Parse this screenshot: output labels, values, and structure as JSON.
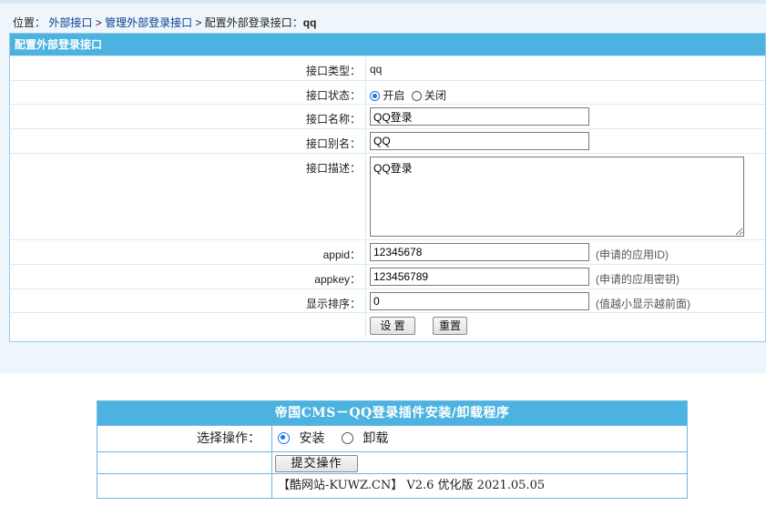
{
  "breadcrumb": {
    "prefix": "位置：",
    "item1": "外部接口",
    "sep1": " > ",
    "item2": "管理外部登录接口",
    "sep2": " > ",
    "item3": "配置外部登录接口：",
    "item3_bold": "qq"
  },
  "form": {
    "header": "配置外部登录接口",
    "type_label": "接口类型：",
    "type_value": "qq",
    "status_label": "接口状态：",
    "status_on": "开启",
    "status_off": "关闭",
    "status_selected": "开启",
    "name_label": "接口名称：",
    "name_value": "QQ登录",
    "alias_label": "接口别名：",
    "alias_value": "QQ",
    "desc_label": "接口描述：",
    "desc_value": "QQ登录",
    "appid_label": "appid：",
    "appid_value": "12345678",
    "appid_hint": "(申请的应用ID)",
    "appkey_label": "appkey：",
    "appkey_value": "123456789",
    "appkey_hint": "(申请的应用密钥)",
    "order_label": "显示排序：",
    "order_value": "0",
    "order_hint": "(值越小显示越前面)",
    "submit_label": "设 置",
    "reset_label": "重置"
  },
  "installer": {
    "title": "帝国CMS－QQ登录插件安装/卸载程序",
    "action_label": "选择操作：",
    "install": "安装",
    "uninstall": "卸载",
    "selected": "安装",
    "submit_label": "提交操作",
    "footer": "【酷网站-KUWZ.CN】 V2.6 优化版 2021.05.05"
  },
  "colors": {
    "header_bg": "#4cb3e0",
    "radio_selected": "#1a73e8"
  }
}
